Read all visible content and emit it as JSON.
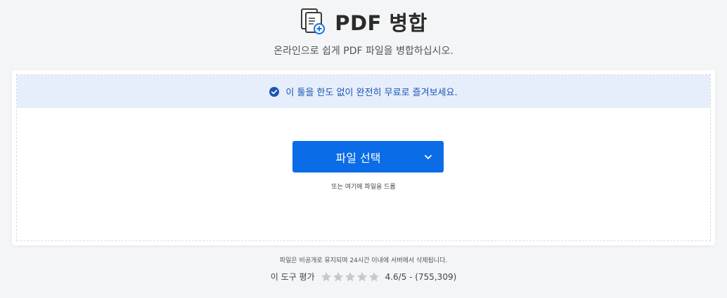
{
  "header": {
    "title": "PDF 병합",
    "subtitle": "온라인으로 쉽게 PDF 파일을 병합하십시오.",
    "icon": "merge-pdf-icon"
  },
  "banner": {
    "text": "이 툴을 한도 없이 완전히 무료로 즐겨보세요.",
    "icon": "check-circle-icon"
  },
  "upload": {
    "button_label": "파일 선택",
    "dropdown_icon": "chevron-down-icon",
    "drop_hint": "또는 여기에 파일을 드롭"
  },
  "footer": {
    "privacy_note": "파일은 비공개로 유지되며 24시간 이내에 서버에서 삭제됩니다.",
    "rating_label": "이 도구 평가",
    "rating_text": "4.6/5 - (755,309)",
    "rating_value": 4.6,
    "rating_max": 5
  },
  "colors": {
    "primary": "#0a6ce6",
    "banner_bg": "#e6eefb",
    "banner_text": "#1a56b0",
    "star_inactive": "#c5c8ce"
  }
}
